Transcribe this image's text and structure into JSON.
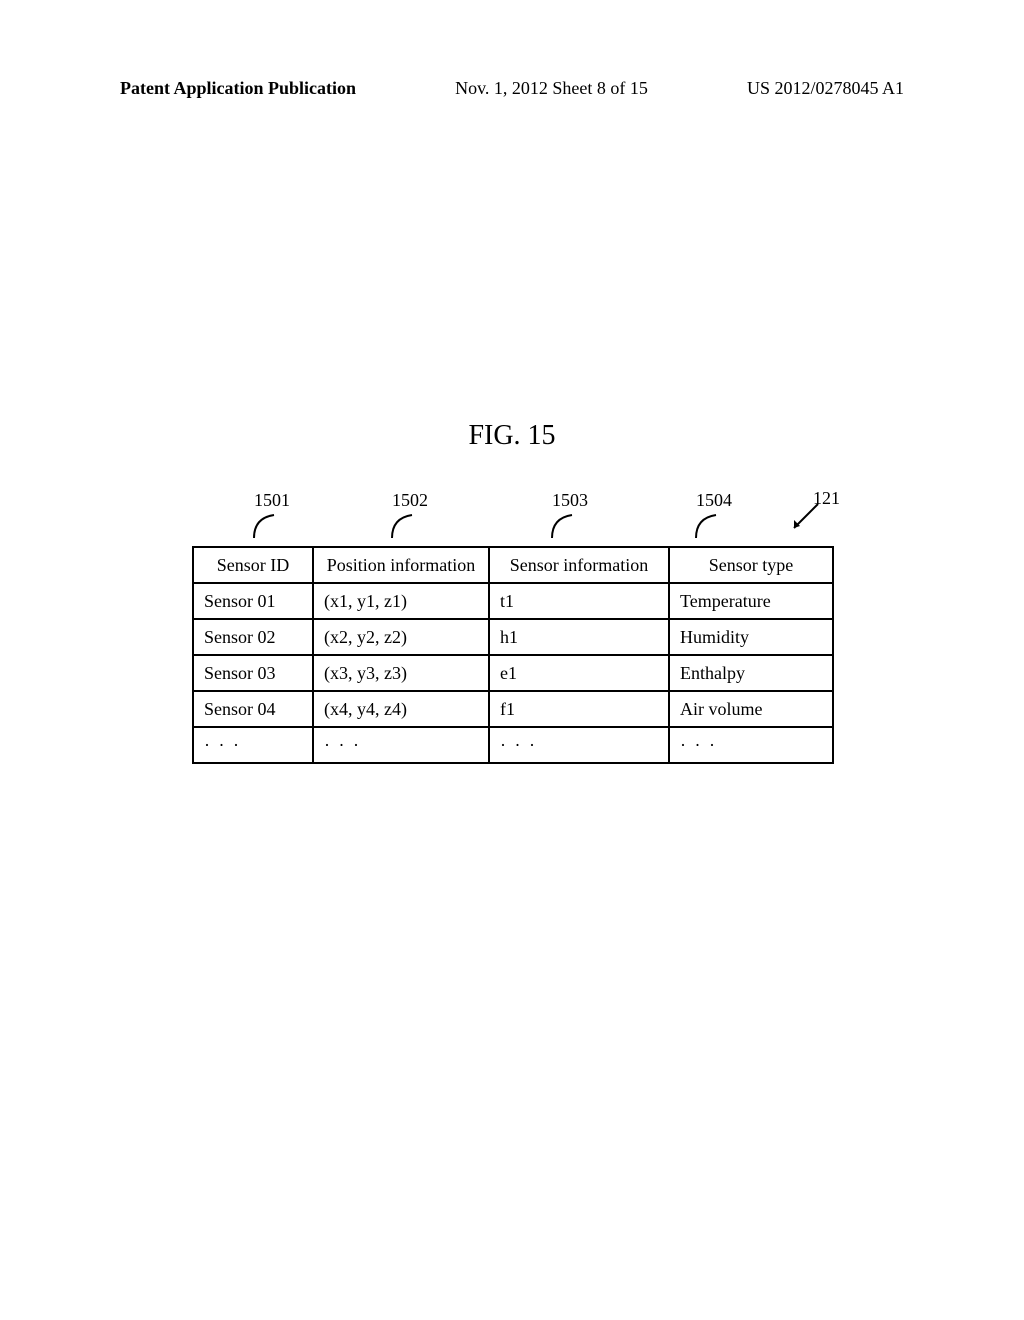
{
  "header": {
    "left": "Patent Application Publication",
    "center": "Nov. 1, 2012  Sheet 8 of 15",
    "right": "US 2012/0278045 A1"
  },
  "figure": {
    "title": "FIG. 15",
    "table_ref": "121",
    "column_refs": [
      "1501",
      "1502",
      "1503",
      "1504"
    ],
    "headers": [
      "Sensor ID",
      "Position information",
      "Sensor information",
      "Sensor type"
    ],
    "rows": [
      {
        "id": "Sensor 01",
        "position": "(x1, y1, z1)",
        "info": "t1",
        "type": "Temperature"
      },
      {
        "id": "Sensor 02",
        "position": "(x2, y2, z2)",
        "info": "h1",
        "type": "Humidity"
      },
      {
        "id": "Sensor 03",
        "position": "(x3, y3, z3)",
        "info": "e1",
        "type": "Enthalpy"
      },
      {
        "id": "Sensor 04",
        "position": "(x4, y4, z4)",
        "info": "f1",
        "type": "Air volume"
      }
    ],
    "ellipsis": "· · ·"
  }
}
